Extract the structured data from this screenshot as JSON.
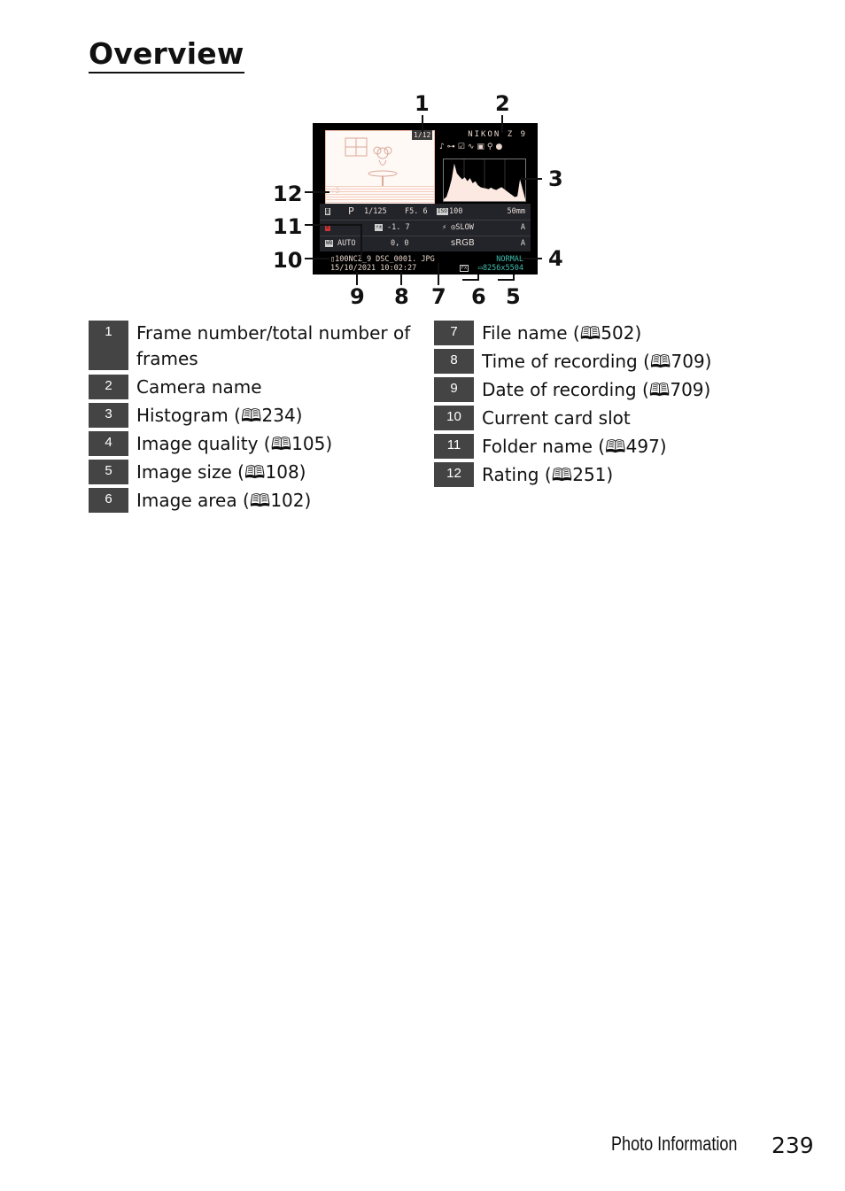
{
  "page": {
    "title": "Overview",
    "footer": {
      "section": "Photo Information",
      "page_number": "239"
    }
  },
  "screen": {
    "frame": "1/12",
    "camera": "NIKON Z 9",
    "rating": "☆5",
    "icons": [
      "voice-memo-icon",
      "protect-icon",
      "retouch-icon",
      "active-d-lighting-icon",
      "picture-control-icon",
      "location-icon",
      "comment-icon"
    ],
    "info_rows": [
      {
        "metering": "metering-icon",
        "mode": "P",
        "shutter": "1/125",
        "aperture": "F5. 6",
        "iso_label": "ISO",
        "iso": "100",
        "focal": "50mm"
      },
      {
        "exp_comp": "-1. 7",
        "exp_comp_label": "flash-comp",
        "flash": "⚡ ◎SLOW",
        "ae": "A"
      },
      {
        "wb_label": "WB",
        "wb": "AUTO",
        "wb_fine": "0,  0",
        "color_space": "sRGB",
        "picture": "A"
      }
    ],
    "folder_file": "100NCZ_9  DSC_0001. JPG",
    "card_slot": "1",
    "datetime": "15/10/2021  10:02:27",
    "quality": "NORMAL",
    "area": "FX",
    "size": "8256x5504",
    "histogram": [
      0.05,
      0.1,
      0.3,
      0.55,
      0.95,
      0.7,
      0.62,
      0.55,
      0.6,
      0.5,
      0.58,
      0.45,
      0.5,
      0.4,
      0.35,
      0.33,
      0.32,
      0.3,
      0.34,
      0.3,
      0.28,
      0.32,
      0.35,
      0.3,
      0.25,
      0.2,
      0.15,
      0.1,
      0.12,
      0.55,
      0.3,
      0.05
    ]
  },
  "callouts": [
    "1",
    "2",
    "3",
    "4",
    "5",
    "6",
    "7",
    "8",
    "9",
    "10",
    "11",
    "12"
  ],
  "legend_left": [
    {
      "num": "1",
      "text": "Frame number/total number of frames"
    },
    {
      "num": "2",
      "text": "Camera name"
    },
    {
      "num": "3",
      "text": "Histogram (🕮234)"
    },
    {
      "num": "4",
      "text": "Image quality (🕮105)"
    },
    {
      "num": "5",
      "text": "Image size (🕮108)"
    },
    {
      "num": "6",
      "text": "Image area (🕮102)"
    }
  ],
  "legend_right": [
    {
      "num": "7",
      "text": "File name (🕮502)"
    },
    {
      "num": "8",
      "text": "Time of recording (🕮709)"
    },
    {
      "num": "9",
      "text": "Date of recording (🕮709)"
    },
    {
      "num": "10",
      "text": "Current card slot"
    },
    {
      "num": "11",
      "text": "Folder name (🕮497)"
    },
    {
      "num": "12",
      "text": "Rating (🕮251)"
    }
  ]
}
